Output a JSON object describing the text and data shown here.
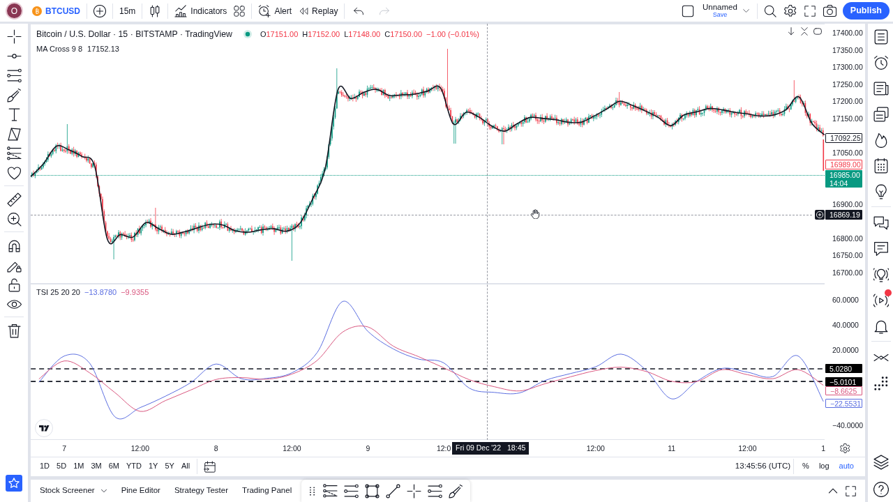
{
  "header": {
    "avatar_letter": "O",
    "symbol": "BTCUSD",
    "interval": "15m",
    "indicators_label": "Indicators",
    "alert_label": "Alert",
    "replay_label": "Replay",
    "undo": {
      "disabled": false
    },
    "redo": {
      "disabled": true
    },
    "layout_name": "Unnamed",
    "save_label": "Save",
    "publish_label": "Publish"
  },
  "chart": {
    "legend": {
      "title": "Bitcoin / U.S. Dollar · 15 · BITSTAMP · TradingView",
      "market_open": true,
      "ohlc": [
        {
          "label": "O",
          "value": "17151.00"
        },
        {
          "label": "H",
          "value": "17152.00"
        },
        {
          "label": "L",
          "value": "17148.00"
        },
        {
          "label": "C",
          "value": "17150.00"
        }
      ],
      "change": "−1.00 (−0.01%)",
      "falling": true
    },
    "price_pane": {
      "ma_value": "17152.13",
      "price_tags": [
        {
          "text": "17092.25",
          "kind": "outline",
          "color": "#131722"
        },
        {
          "text": "16989.00",
          "kind": "outline",
          "color": "#f23645"
        },
        {
          "text": "16985.00",
          "countdown": "14:04",
          "kind": "last",
          "color": "#089981"
        }
      ],
      "chart_data": {
        "type": "line",
        "categories": [
          null,
          null,
          null,
          null,
          null,
          null,
          null,
          null,
          null,
          null,
          null,
          null,
          null,
          null,
          null,
          null,
          null,
          null,
          null,
          null,
          null,
          null,
          null,
          null,
          null,
          null,
          null,
          null,
          null,
          null,
          null,
          null,
          null,
          null,
          null,
          null,
          null,
          null,
          null,
          null,
          null,
          null,
          null,
          null,
          null,
          null,
          null,
          null,
          null,
          null,
          null,
          null,
          null,
          null,
          null,
          null,
          null,
          null,
          null,
          null,
          null,
          null,
          null
        ],
        "series": [
          {
            "name": "MA Cross 9 8",
            "color": "#131722",
            "values": [
              16980,
              17018,
              17069,
              17058,
              17039,
              17010,
              16796,
              16811,
              16804,
              16846,
              16828,
              16812,
              16819,
              16830,
              16841,
              16839,
              16822,
              16818,
              16825,
              16828,
              16821,
              16843,
              16914,
              17005,
              17234,
              17208,
              17226,
              17235,
              17217,
              17219,
              17221,
              17230,
              17239,
              17134,
              17168,
              17154,
              17128,
              17113,
              17135,
              17153,
              17150,
              17146,
              17139,
              17139,
              17157,
              17178,
              17200,
              17188,
              17172,
              17153,
              17129,
              17160,
              17169,
              17179,
              17175,
              17168,
              17163,
              17157,
              17160,
              17176,
              17213,
              17136,
              17102
            ]
          }
        ],
        "ylim": [
          16669.5,
          17426.5
        ],
        "yticks": [
          {
            "value": 17400,
            "label": "17400.00"
          },
          {
            "value": 17350,
            "label": "17350.00"
          },
          {
            "value": 17300,
            "label": "17300.00"
          },
          {
            "value": 17250,
            "label": "17250.00"
          },
          {
            "value": 17200,
            "label": "17200.00"
          },
          {
            "value": 17150,
            "label": "17150.00"
          },
          {
            "value": 17050,
            "label": "17050.00"
          },
          {
            "value": 16900,
            "label": "16900.00"
          },
          {
            "value": 16800,
            "label": "16800.00"
          },
          {
            "value": 16750,
            "label": "16750.00"
          },
          {
            "value": 16700,
            "label": "16700.00"
          }
        ]
      }
    },
    "crosshair": {
      "price": "16869.19",
      "date": "Fri 09 Dec '22",
      "time": "18:45"
    },
    "tsi_pane": {
      "name": "TSI 25 20 20",
      "readings": [
        "−13.8780",
        "−9.9355"
      ],
      "tags": [
        {
          "text": "5.0280",
          "kind": "filled",
          "color": "#000000"
        },
        {
          "text": "−5.0101",
          "kind": "filled",
          "color": "#000000"
        },
        {
          "text": "−8.6625",
          "kind": "outline",
          "color": "#d9577f"
        },
        {
          "text": "−22.5531",
          "kind": "outline",
          "color": "#5b6ee1"
        }
      ],
      "chart_data": {
        "type": "line",
        "categories": [
          null,
          "7",
          null,
          null,
          "12:00",
          null,
          null,
          "8",
          null,
          null,
          "12:00",
          null,
          null,
          "9",
          null,
          null,
          "12:0",
          null,
          null,
          null,
          null,
          null,
          "12:00",
          null,
          null,
          "11",
          null,
          null,
          "12:00",
          null,
          null,
          "1"
        ],
        "series": [
          {
            "color": "#5b6ee1",
            "values": [
              -5.7,
              15.2,
              9.6,
              -33.2,
              -25.9,
              -16.8,
              -6.0,
              8.8,
              -2.9,
              -2.6,
              1.9,
              18.1,
              58.7,
              34.9,
              20.9,
              12.8,
              9.7,
              -10.3,
              -13.8,
              -14.2,
              -4.3,
              1.2,
              6.6,
              16.7,
              3.8,
              -18.9,
              -4.9,
              5.3,
              2.3,
              -1.2,
              15.3,
              -21.0
            ]
          },
          {
            "color": "#d9577f",
            "values": [
              -3.1,
              11.3,
              1.9,
              -13.9,
              -28.9,
              -20.3,
              -11.9,
              -3.5,
              -2.0,
              -3.3,
              0.8,
              11.8,
              34.3,
              38.4,
              23.1,
              14.7,
              5.8,
              -3.6,
              -9.3,
              -12.6,
              -6.9,
              -1.4,
              3.6,
              6.3,
              2.9,
              -4.9,
              -5.1,
              4.3,
              0.3,
              -2.9,
              4.3,
              -8.1
            ]
          }
        ],
        "ylim": [
          -51.7,
          72.8
        ],
        "yticks": [
          {
            "value": 60,
            "label": "60.0000"
          },
          {
            "value": 40,
            "label": "40.0000"
          },
          {
            "value": 20,
            "label": "20.0000"
          },
          {
            "value": -40,
            "label": "−40.0000"
          }
        ]
      }
    }
  },
  "range_bar": {
    "ranges": [
      "1D",
      "5D",
      "1M",
      "3M",
      "6M",
      "YTD",
      "1Y",
      "5Y",
      "All"
    ],
    "clock": "13:45:56 (UTC)",
    "scale_options": [
      {
        "label": "%",
        "selected": false
      },
      {
        "label": "log",
        "selected": false
      },
      {
        "label": "auto",
        "selected": true
      }
    ]
  },
  "bottom_panel": {
    "tabs": [
      {
        "label": "Stock Screener",
        "dropdown": true
      },
      {
        "label": "Pine Editor",
        "dropdown": false
      },
      {
        "label": "Strategy Tester",
        "dropdown": false
      },
      {
        "label": "Trading Panel",
        "dropdown": false
      }
    ]
  },
  "right_sidebar": {
    "streams_notification": true
  }
}
